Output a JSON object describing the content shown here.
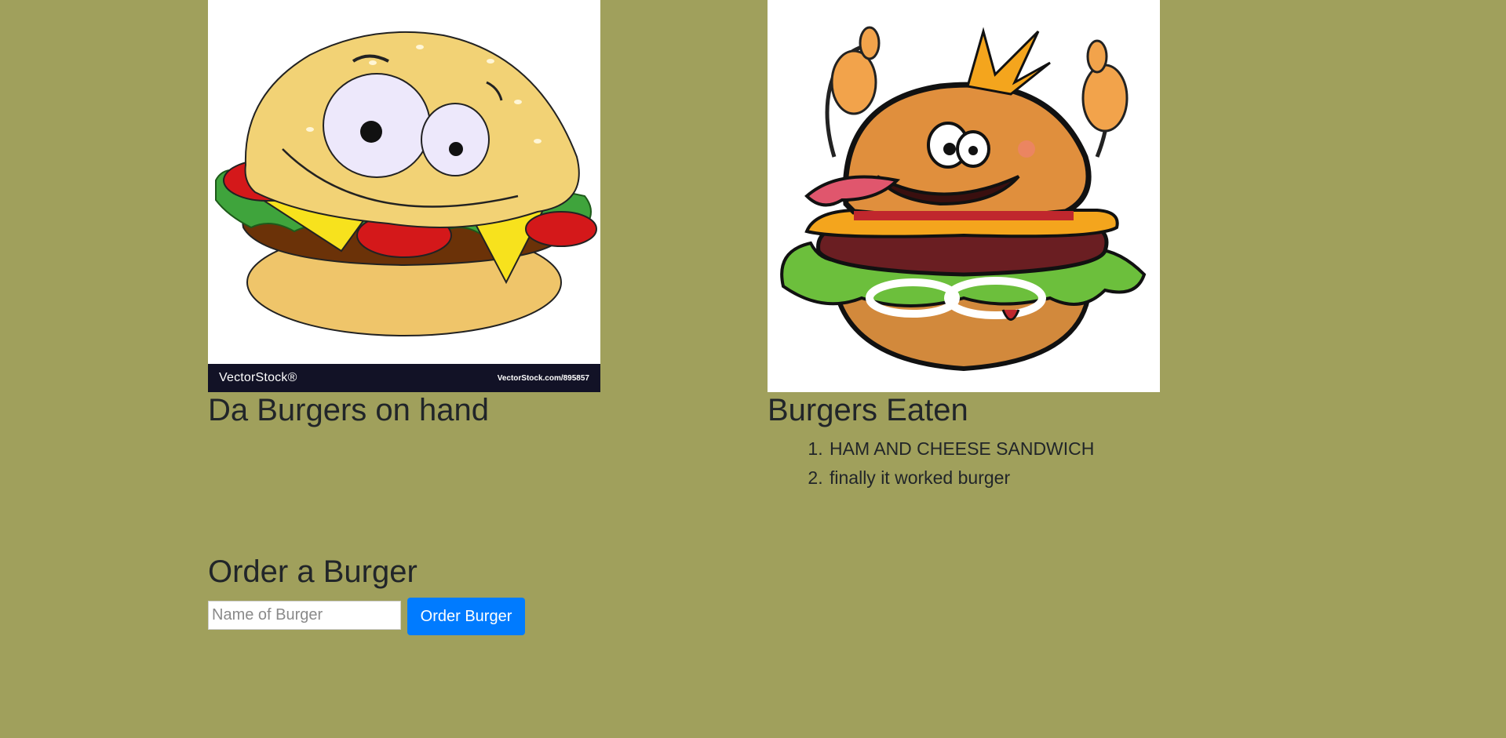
{
  "left": {
    "image_watermark": {
      "brand": "VectorStock®",
      "url": "VectorStock.com/895857"
    },
    "title": "Da Burgers on hand"
  },
  "right": {
    "title": "Burgers Eaten",
    "eaten": [
      "HAM AND CHEESE SANDWICH",
      "finally it worked burger"
    ]
  },
  "order": {
    "title": "Order a Burger",
    "input_placeholder": "Name of Burger",
    "input_value": "",
    "button_label": "Order Burger"
  },
  "colors": {
    "page_background": "#a0a05c",
    "button_primary": "#007bff",
    "text": "#212529"
  }
}
